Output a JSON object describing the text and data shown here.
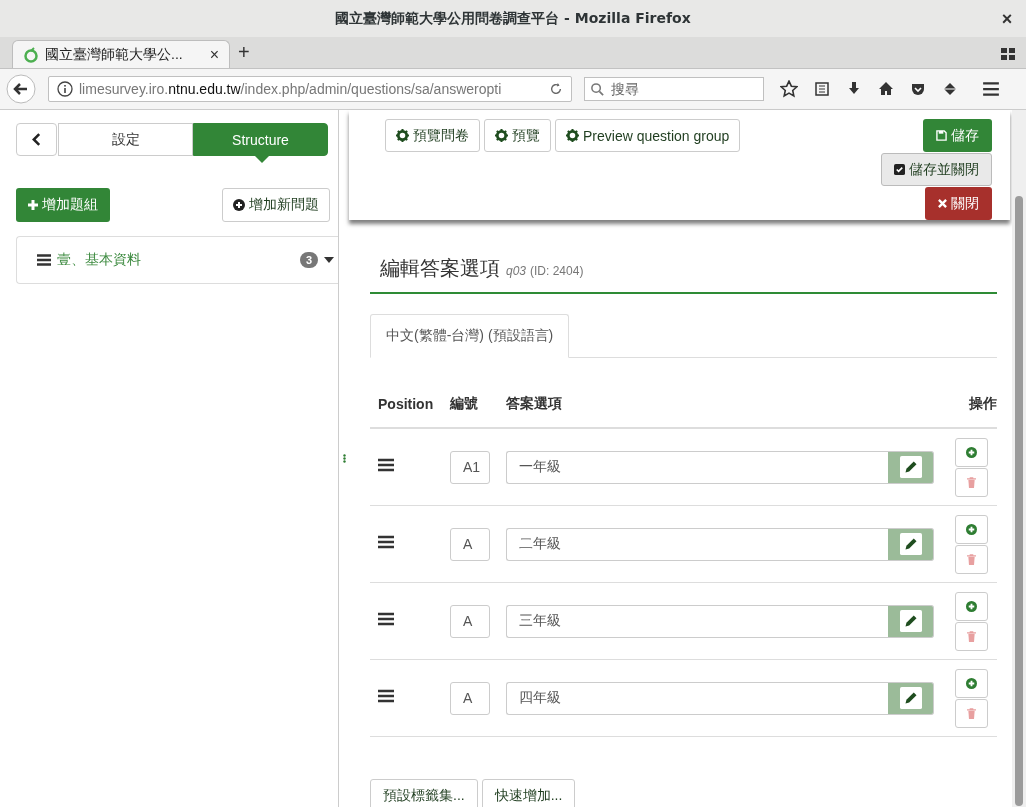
{
  "window": {
    "title": "國立臺灣師範大學公用問卷調查平台 - Mozilla Firefox",
    "close": "×"
  },
  "browser_tabs": [
    {
      "title": "國立臺灣師範大學公...",
      "close": "×",
      "selected": true
    }
  ],
  "new_tab": "+",
  "address_bar": {
    "url_host_pre": "limesurvey.iro.",
    "url_host": "ntnu.edu.tw",
    "url_path": "/index.php/admin/questions/sa/answeropti"
  },
  "search": {
    "placeholder": "搜尋"
  },
  "sidebar": {
    "tabs": [
      {
        "label": "設定",
        "selected": false
      },
      {
        "label": "Structure",
        "selected": true
      }
    ],
    "add_group": "增加題組",
    "add_question": "增加新問題",
    "groups": [
      {
        "label": "壹、基本資料",
        "count": "3"
      }
    ]
  },
  "toolbar": {
    "buttons": [
      "預覽問卷",
      "預覽",
      "Preview question group"
    ],
    "save": "儲存",
    "save_close": "儲存並關閉",
    "close": "關閉"
  },
  "heading": {
    "title": "編輯答案選項",
    "code": "q03",
    "id": "(ID: 2404)"
  },
  "language_tabs": [
    {
      "label": "中文(繁體-台灣) (預設語言)",
      "selected": true
    }
  ],
  "table": {
    "columns": [
      "Position",
      "編號",
      "答案選項",
      "操作"
    ],
    "rows": [
      {
        "code": "A1",
        "answer": "一年級"
      },
      {
        "code": "A",
        "answer": "二年級"
      },
      {
        "code": "A",
        "answer": "三年級"
      },
      {
        "code": "A",
        "answer": "四年級"
      }
    ]
  },
  "footer_buttons": [
    "預設標籤集...",
    "快速增加..."
  ]
}
